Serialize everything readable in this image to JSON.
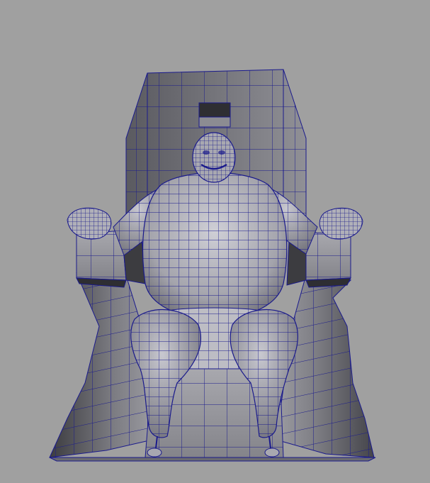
{
  "viewport": {
    "background_color": "#a0a0a0",
    "mesh_wire_color": "#1a1a8c",
    "surface_light": "#b4b4bc",
    "surface_mid": "#8a8a90",
    "surface_dark": "#4a4a4e",
    "surface_shadow": "#2e2e32"
  },
  "model": {
    "icon": "wireframe-mesh-icon"
  }
}
